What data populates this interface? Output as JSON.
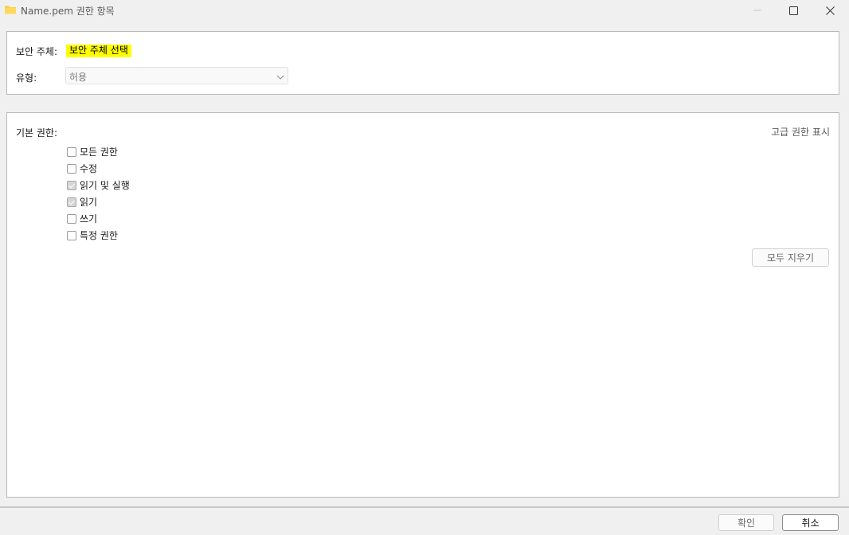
{
  "window": {
    "title": "Name.pem 권한 항목",
    "icon": "folder-icon",
    "controls": [
      "minimize-icon",
      "maximize-icon",
      "close-icon"
    ]
  },
  "principal": {
    "label": "보안 주체:",
    "link_text": "보안 주체 선택",
    "highlight_color": "#ffff00"
  },
  "type": {
    "label": "유형:",
    "value": "허용"
  },
  "permissions": {
    "label": "기본 권한:",
    "advanced_link": "고급 권한 표시",
    "items": [
      {
        "label": "모든 권한",
        "checked": false
      },
      {
        "label": "수정",
        "checked": false
      },
      {
        "label": "읽기 및 실행",
        "checked": true
      },
      {
        "label": "읽기",
        "checked": true
      },
      {
        "label": "쓰기",
        "checked": false
      },
      {
        "label": "특정 권한",
        "checked": false
      }
    ],
    "clear_all": "모두 지우기"
  },
  "footer": {
    "ok": "확인",
    "cancel": "취소"
  }
}
